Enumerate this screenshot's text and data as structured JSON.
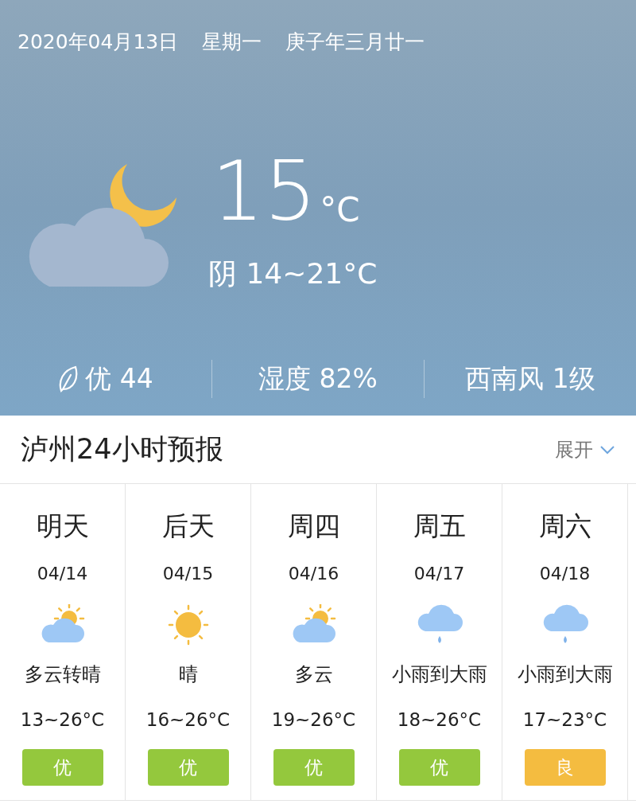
{
  "date_line": {
    "date": "2020年04月13日",
    "weekday": "星期一",
    "lunar": "庚子年三月廿一"
  },
  "current": {
    "kind": "cloudy_night",
    "temperature": "15",
    "unit": "°C",
    "summary": "阴 14~21°C"
  },
  "stats": [
    {
      "kind": "air",
      "text": "优 44"
    },
    {
      "kind": "plain",
      "text": "湿度 82%"
    },
    {
      "kind": "plain",
      "text": "西南风 1级"
    }
  ],
  "forecast_header": {
    "title": "泸州24小时预报",
    "expand": "展开",
    "expanded": false
  },
  "days": [
    {
      "day": "明天",
      "date": "04/14",
      "kind": "partly_cloudy",
      "condition": "多云转晴",
      "temps": "13~26°C",
      "aqi": "优",
      "color": "#94c83d"
    },
    {
      "day": "后天",
      "date": "04/15",
      "kind": "sunny",
      "condition": "晴",
      "temps": "16~26°C",
      "aqi": "优",
      "color": "#94c83d"
    },
    {
      "day": "周四",
      "date": "04/16",
      "kind": "partly_cloudy",
      "condition": "多云",
      "temps": "19~26°C",
      "aqi": "优",
      "color": "#94c83d"
    },
    {
      "day": "周五",
      "date": "04/17",
      "kind": "rain",
      "condition": "小雨到大雨",
      "temps": "18~26°C",
      "aqi": "优",
      "color": "#94c83d"
    },
    {
      "day": "周六",
      "date": "04/18",
      "kind": "rain",
      "condition": "小雨到大雨",
      "temps": "17~23°C",
      "aqi": "良",
      "color": "#f4bc40"
    }
  ]
}
